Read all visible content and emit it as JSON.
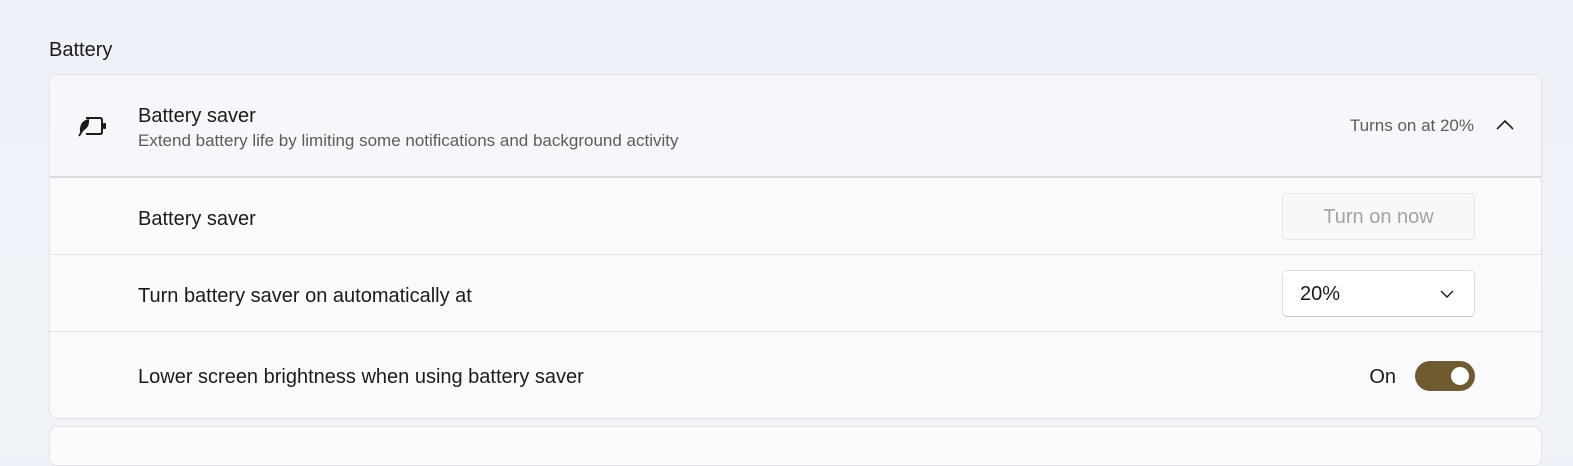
{
  "section": {
    "title": "Battery"
  },
  "battery_saver_card": {
    "icon": "battery-saver-icon",
    "title": "Battery saver",
    "subtitle": "Extend battery life by limiting some notifications and background activity",
    "status": "Turns on at 20%",
    "expanded": true,
    "rows": {
      "manual": {
        "label": "Battery saver",
        "button_label": "Turn on now",
        "button_disabled": true
      },
      "auto_threshold": {
        "label": "Turn battery saver on automatically at",
        "selected_value": "20%"
      },
      "lower_brightness": {
        "label": "Lower screen brightness when using battery saver",
        "toggle_state_label": "On",
        "toggle_on": true
      }
    }
  },
  "colors": {
    "accent": "#6e5c30",
    "card_background": "#fbfbfd",
    "page_background": "#eef2f8"
  }
}
